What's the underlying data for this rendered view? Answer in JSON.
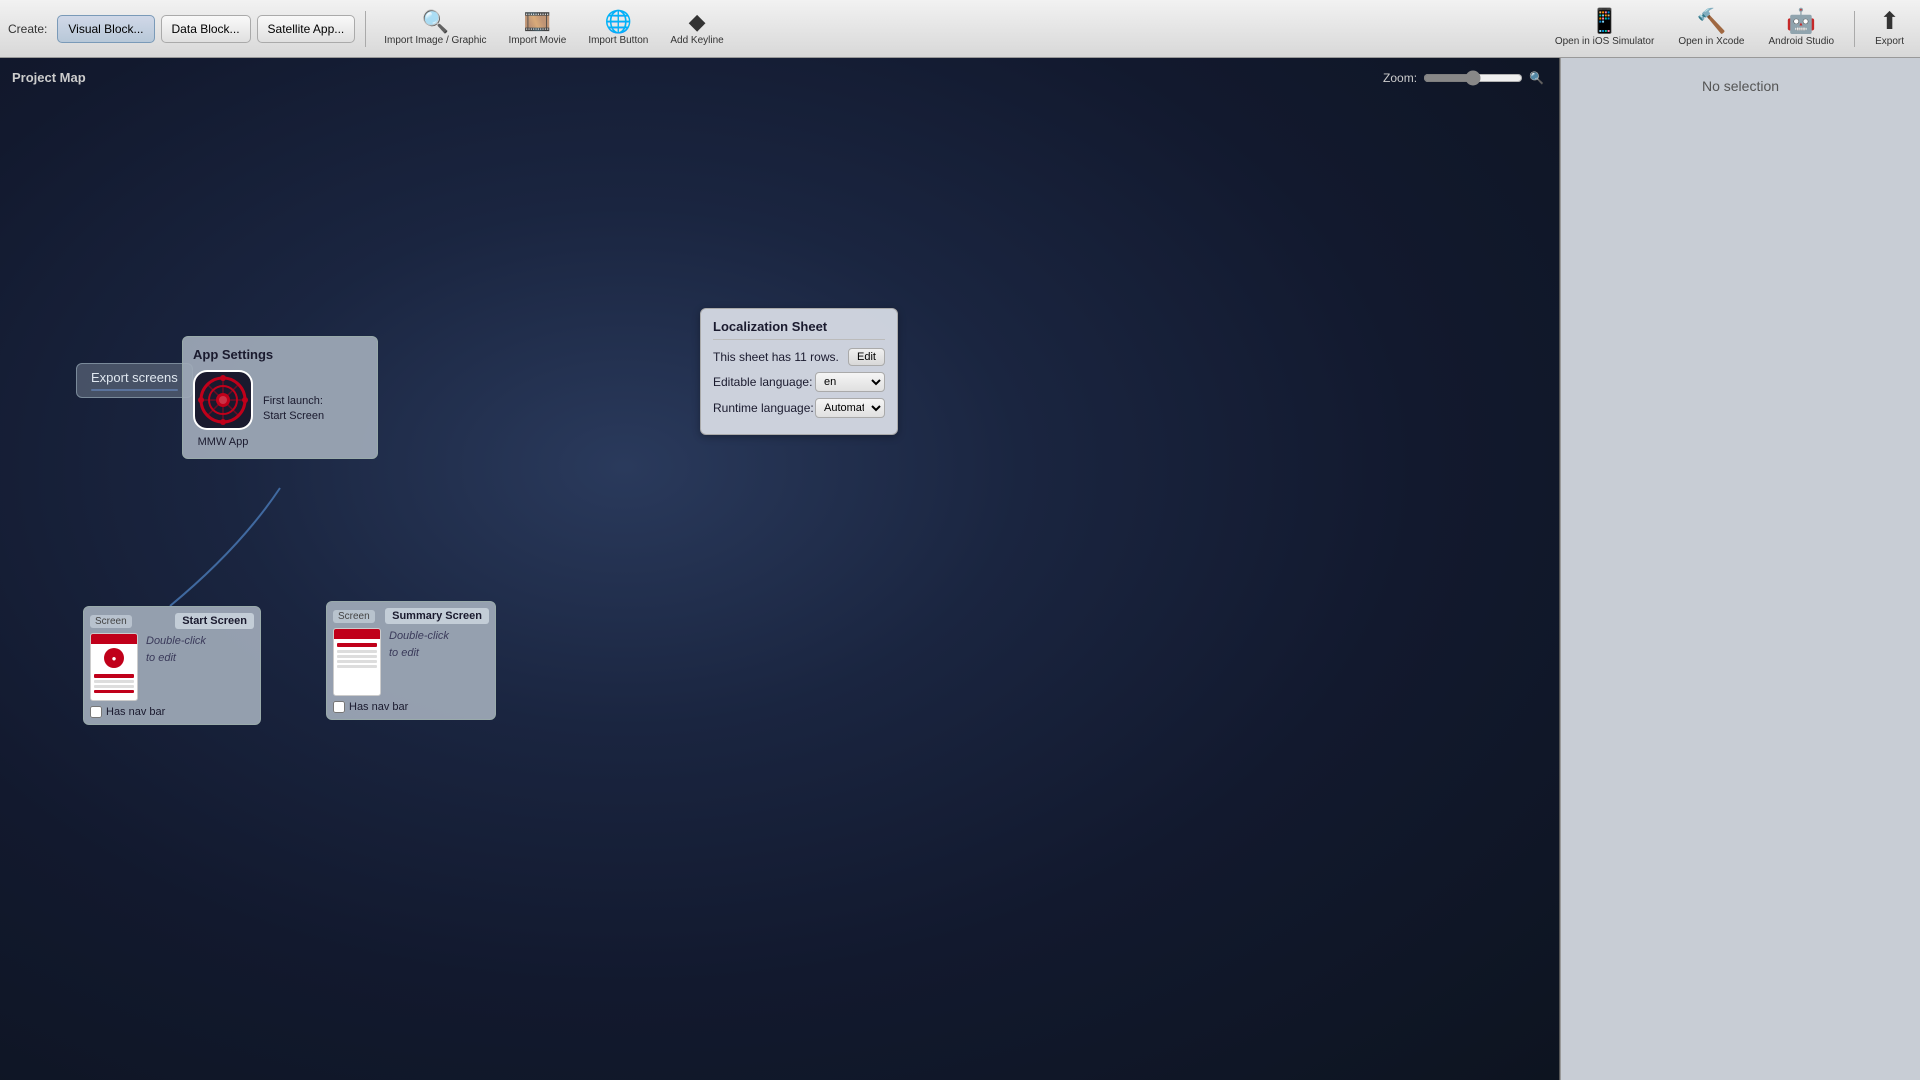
{
  "toolbar": {
    "create_label": "Create:",
    "visual_block_label": "Visual Block...",
    "data_block_label": "Data Block...",
    "satellite_app_label": "Satellite App...",
    "import_image_label": "Import Image / Graphic",
    "import_movie_label": "Import Movie",
    "import_button_label": "Import Button",
    "add_keyline_label": "Add Keyline",
    "open_ios_label": "Open in iOS Simulator",
    "open_xcode_label": "Open in Xcode",
    "android_studio_label": "Android Studio",
    "export_label": "Export"
  },
  "canvas": {
    "title": "Project Map",
    "zoom_label": "Zoom:",
    "zoom_value": 50
  },
  "export_screens": {
    "label": "Export screens"
  },
  "app_settings": {
    "title": "App Settings",
    "launch_label": "First launch:",
    "launch_screen": "Start Screen",
    "app_name": "MMW App"
  },
  "localization_sheet": {
    "title": "Localization Sheet",
    "rows_info": "This sheet has 11 rows.",
    "edit_label": "Edit",
    "editable_language_label": "Editable language:",
    "editable_language_value": "en",
    "runtime_language_label": "Runtime language:",
    "runtime_language_value": "Automatic"
  },
  "start_screen": {
    "type": "Screen",
    "name": "Start Screen",
    "hint1": "Double-click",
    "hint2": "to edit",
    "nav_bar_label": "Has nav bar"
  },
  "summary_screen": {
    "type": "Screen",
    "name": "Summary Screen",
    "hint1": "Double-click",
    "hint2": "to edit",
    "nav_bar_label": "Has nav bar"
  },
  "right_panel": {
    "no_selection": "No selection"
  },
  "icons": {
    "search": "🔍",
    "grid": "⊞",
    "globe": "🌐",
    "diamond": "◆",
    "ios_sim": "📱",
    "xcode": "🔨",
    "android": "🤖",
    "export": "⬆",
    "add": "+"
  }
}
